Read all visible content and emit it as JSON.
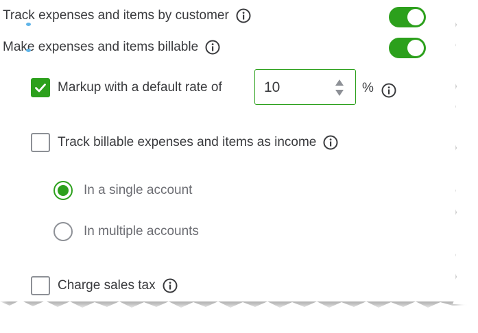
{
  "settings": {
    "track_expenses": {
      "label": "Track expenses and items by customer",
      "enabled": true
    },
    "billable": {
      "label": "Make expenses and items billable",
      "enabled": true
    },
    "markup": {
      "label": "Markup with a default rate of",
      "checked": true,
      "rate_value": "10",
      "unit": "%"
    },
    "track_income": {
      "label": "Track billable expenses and items as income",
      "checked": false,
      "options": [
        {
          "label": "In a single account",
          "selected": true
        },
        {
          "label": "In multiple accounts",
          "selected": false
        }
      ]
    },
    "sales_tax": {
      "label": "Charge sales tax",
      "checked": false
    }
  },
  "icons": {
    "info": "info-circle-icon",
    "check": "checkmark-icon",
    "stepper": "up-down-stepper-icon"
  },
  "colors": {
    "accent": "#2ca01c",
    "text": "#393a3d",
    "muted_text": "#6b6c72",
    "border": "#8d9096",
    "stepper": "#8d9096"
  }
}
